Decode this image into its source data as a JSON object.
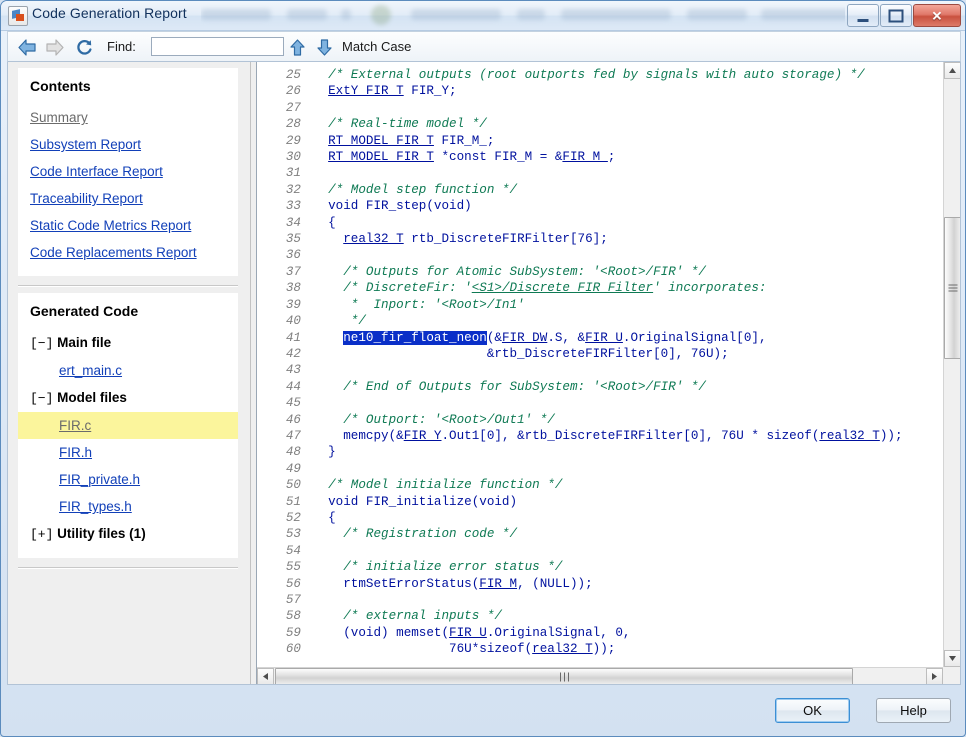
{
  "window": {
    "title": "Code Generation Report",
    "icon": "report-icon",
    "minimize_label": "Minimize",
    "maximize_label": "Maximize",
    "close_label": "✕"
  },
  "toolbar": {
    "back_icon": "back-arrow-icon",
    "forward_icon": "forward-arrow-icon",
    "refresh_icon": "refresh-icon",
    "find_label": "Find:",
    "find_value": "",
    "find_placeholder": "",
    "find_prev_icon": "up-arrow-icon",
    "find_next_icon": "down-arrow-icon",
    "match_case_label": "Match Case"
  },
  "sidebar": {
    "contents": {
      "heading": "Contents",
      "links": [
        {
          "label": "Summary",
          "visited": true
        },
        {
          "label": "Subsystem Report",
          "visited": false
        },
        {
          "label": "Code Interface Report",
          "visited": false
        },
        {
          "label": "Traceability Report",
          "visited": false
        },
        {
          "label": "Static Code Metrics Report",
          "visited": false
        },
        {
          "label": "Code Replacements Report",
          "visited": false
        }
      ]
    },
    "generated_code": {
      "heading": "Generated Code",
      "groups": [
        {
          "toggle": "[−]",
          "label": "Main file",
          "files": [
            {
              "label": "ert_main.c",
              "selected": false
            }
          ]
        },
        {
          "toggle": "[−]",
          "label": "Model files",
          "files": [
            {
              "label": "FIR.c",
              "selected": true
            },
            {
              "label": "FIR.h",
              "selected": false
            },
            {
              "label": "FIR_private.h",
              "selected": false
            },
            {
              "label": "FIR_types.h",
              "selected": false
            }
          ]
        },
        {
          "toggle": "[+]",
          "label": "Utility files (1)",
          "files": []
        }
      ]
    }
  },
  "code": {
    "first_line_number": 25,
    "lines": [
      {
        "n": 25,
        "parts": [
          {
            "t": "comment",
            "s": "  /* External outputs (root outports fed by signals with auto storage) */"
          }
        ]
      },
      {
        "n": 26,
        "parts": [
          {
            "t": "plain",
            "s": "  "
          },
          {
            "t": "link",
            "s": "ExtY_FIR_T"
          },
          {
            "t": "plain",
            "s": " FIR_Y;"
          }
        ]
      },
      {
        "n": 27,
        "parts": [
          {
            "t": "plain",
            "s": ""
          }
        ]
      },
      {
        "n": 28,
        "parts": [
          {
            "t": "comment",
            "s": "  /* Real-time model */"
          }
        ]
      },
      {
        "n": 29,
        "parts": [
          {
            "t": "plain",
            "s": "  "
          },
          {
            "t": "link",
            "s": "RT_MODEL_FIR_T"
          },
          {
            "t": "plain",
            "s": " FIR_M_;"
          }
        ]
      },
      {
        "n": 30,
        "parts": [
          {
            "t": "plain",
            "s": "  "
          },
          {
            "t": "link",
            "s": "RT_MODEL_FIR_T"
          },
          {
            "t": "plain",
            "s": " *const FIR_M = &"
          },
          {
            "t": "link",
            "s": "FIR_M_"
          },
          {
            "t": "plain",
            "s": ";"
          }
        ]
      },
      {
        "n": 31,
        "parts": [
          {
            "t": "plain",
            "s": ""
          }
        ]
      },
      {
        "n": 32,
        "parts": [
          {
            "t": "comment",
            "s": "  /* Model step function */"
          }
        ]
      },
      {
        "n": 33,
        "parts": [
          {
            "t": "plain",
            "s": "  void FIR_step(void)"
          }
        ]
      },
      {
        "n": 34,
        "parts": [
          {
            "t": "plain",
            "s": "  {"
          }
        ]
      },
      {
        "n": 35,
        "parts": [
          {
            "t": "plain",
            "s": "    "
          },
          {
            "t": "link",
            "s": "real32_T"
          },
          {
            "t": "plain",
            "s": " rtb_DiscreteFIRFilter[76];"
          }
        ]
      },
      {
        "n": 36,
        "parts": [
          {
            "t": "plain",
            "s": ""
          }
        ]
      },
      {
        "n": 37,
        "parts": [
          {
            "t": "comment",
            "s": "    /* Outputs for Atomic SubSystem: '<Root>/FIR' */"
          }
        ]
      },
      {
        "n": 38,
        "parts": [
          {
            "t": "comment",
            "s": "    /* DiscreteFir: '"
          },
          {
            "t": "commentlink",
            "s": "<S1>/Discrete FIR Filter"
          },
          {
            "t": "comment",
            "s": "' incorporates:"
          }
        ]
      },
      {
        "n": 39,
        "parts": [
          {
            "t": "comment",
            "s": "     *  Inport: '<Root>/In1'"
          }
        ]
      },
      {
        "n": 40,
        "parts": [
          {
            "t": "comment",
            "s": "     */"
          }
        ]
      },
      {
        "n": 41,
        "parts": [
          {
            "t": "plain",
            "s": "    "
          },
          {
            "t": "sel",
            "s": "ne10_fir_float_neon"
          },
          {
            "t": "plain",
            "s": "(&"
          },
          {
            "t": "link",
            "s": "FIR_DW"
          },
          {
            "t": "plain",
            "s": ".S, &"
          },
          {
            "t": "link",
            "s": "FIR_U"
          },
          {
            "t": "plain",
            "s": ".OriginalSignal[0],"
          }
        ]
      },
      {
        "n": 42,
        "parts": [
          {
            "t": "plain",
            "s": "                       &rtb_DiscreteFIRFilter[0], 76U);"
          }
        ]
      },
      {
        "n": 43,
        "parts": [
          {
            "t": "plain",
            "s": ""
          }
        ]
      },
      {
        "n": 44,
        "parts": [
          {
            "t": "comment",
            "s": "    /* End of Outputs for SubSystem: '<Root>/FIR' */"
          }
        ]
      },
      {
        "n": 45,
        "parts": [
          {
            "t": "plain",
            "s": ""
          }
        ]
      },
      {
        "n": 46,
        "parts": [
          {
            "t": "comment",
            "s": "    /* Outport: '<Root>/Out1' */"
          }
        ]
      },
      {
        "n": 47,
        "parts": [
          {
            "t": "plain",
            "s": "    memcpy(&"
          },
          {
            "t": "link",
            "s": "FIR_Y"
          },
          {
            "t": "plain",
            "s": ".Out1[0], &rtb_DiscreteFIRFilter[0], 76U * sizeof("
          },
          {
            "t": "link",
            "s": "real32_T"
          },
          {
            "t": "plain",
            "s": "));"
          }
        ]
      },
      {
        "n": 48,
        "parts": [
          {
            "t": "plain",
            "s": "  }"
          }
        ]
      },
      {
        "n": 49,
        "parts": [
          {
            "t": "plain",
            "s": ""
          }
        ]
      },
      {
        "n": 50,
        "parts": [
          {
            "t": "comment",
            "s": "  /* Model initialize function */"
          }
        ]
      },
      {
        "n": 51,
        "parts": [
          {
            "t": "plain",
            "s": "  void FIR_initialize(void)"
          }
        ]
      },
      {
        "n": 52,
        "parts": [
          {
            "t": "plain",
            "s": "  {"
          }
        ]
      },
      {
        "n": 53,
        "parts": [
          {
            "t": "comment",
            "s": "    /* Registration code */"
          }
        ]
      },
      {
        "n": 54,
        "parts": [
          {
            "t": "plain",
            "s": ""
          }
        ]
      },
      {
        "n": 55,
        "parts": [
          {
            "t": "comment",
            "s": "    /* initialize error status */"
          }
        ]
      },
      {
        "n": 56,
        "parts": [
          {
            "t": "plain",
            "s": "    rtmSetErrorStatus("
          },
          {
            "t": "link",
            "s": "FIR_M"
          },
          {
            "t": "plain",
            "s": ", (NULL));"
          }
        ]
      },
      {
        "n": 57,
        "parts": [
          {
            "t": "plain",
            "s": ""
          }
        ]
      },
      {
        "n": 58,
        "parts": [
          {
            "t": "comment",
            "s": "    /* external inputs */"
          }
        ]
      },
      {
        "n": 59,
        "parts": [
          {
            "t": "plain",
            "s": "    (void) memset("
          },
          {
            "t": "link",
            "s": "FIR_U"
          },
          {
            "t": "plain",
            "s": ".OriginalSignal, 0,"
          }
        ]
      },
      {
        "n": 60,
        "parts": [
          {
            "t": "plain",
            "s": "                  76U*sizeof("
          },
          {
            "t": "link",
            "s": "real32_T"
          },
          {
            "t": "plain",
            "s": "));"
          }
        ]
      }
    ]
  },
  "scrollbars": {
    "vertical": {
      "up_icon": "scroll-up-icon",
      "down_icon": "scroll-down-icon",
      "grip": "≡"
    },
    "horizontal": {
      "left_icon": "scroll-left-icon",
      "right_icon": "scroll-right-icon",
      "grip": "|||"
    }
  },
  "footer": {
    "ok_label": "OK",
    "help_label": "Help"
  },
  "colors": {
    "link": "#1240b8",
    "visited_link": "#6b6b6b",
    "comment_green": "#0f7a54",
    "code_blue": "#00119e",
    "selection_blue": "#0a2fc8",
    "highlight_yellow": "#fbf59c",
    "window_chrome": "#d6e3f2"
  }
}
